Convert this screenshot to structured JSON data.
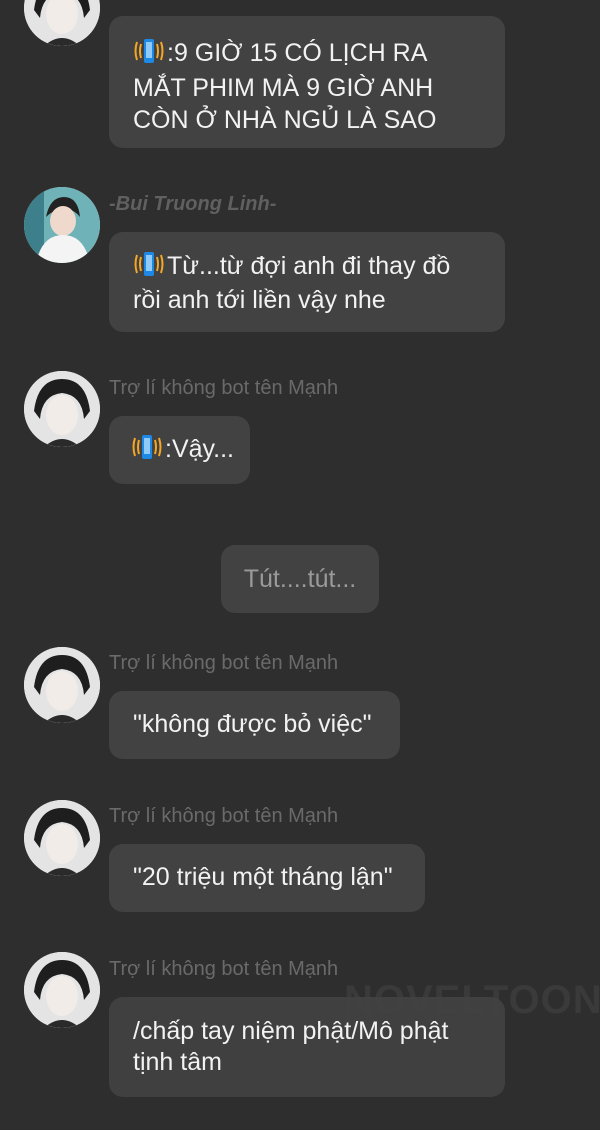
{
  "messages": [
    {
      "sender": "",
      "text": ":9 GIỜ 15 CÓ LỊCH RA MẮT PHIM MÀ 9 GIỜ ANH CÒN Ở NHÀ NGỦ LÀ SAO",
      "phone_icon": true
    },
    {
      "sender": "-Bui Truong Linh-",
      "text": "Từ...từ đợi anh đi thay đồ rồi anh tới liền vậy nhe",
      "phone_icon": true
    },
    {
      "sender": "Trợ lí không bot tên Mạnh",
      "text": ":Vậy...",
      "phone_icon": true
    },
    {
      "system": "Tút....tút..."
    },
    {
      "sender": "Trợ lí không bot tên Mạnh",
      "text": "\"không được bỏ việc\""
    },
    {
      "sender": "Trợ lí không bot tên Mạnh",
      "text": "\"20 triệu một tháng lận\""
    },
    {
      "sender": "Trợ lí không bot tên Mạnh",
      "text": "/chấp tay niệm phật/Mô phật tịnh tâm"
    }
  ],
  "watermark": "NOVELTOON",
  "icons": {
    "phone": "vibrating-phone-icon",
    "avatar_assistant": "dark-hair-avatar",
    "avatar_linh": "white-shirt-avatar"
  },
  "colors": {
    "background": "#2e2e2e",
    "bubble": "#424242",
    "phone_body": "#1e88e5",
    "phone_waves": "#f5a623"
  }
}
